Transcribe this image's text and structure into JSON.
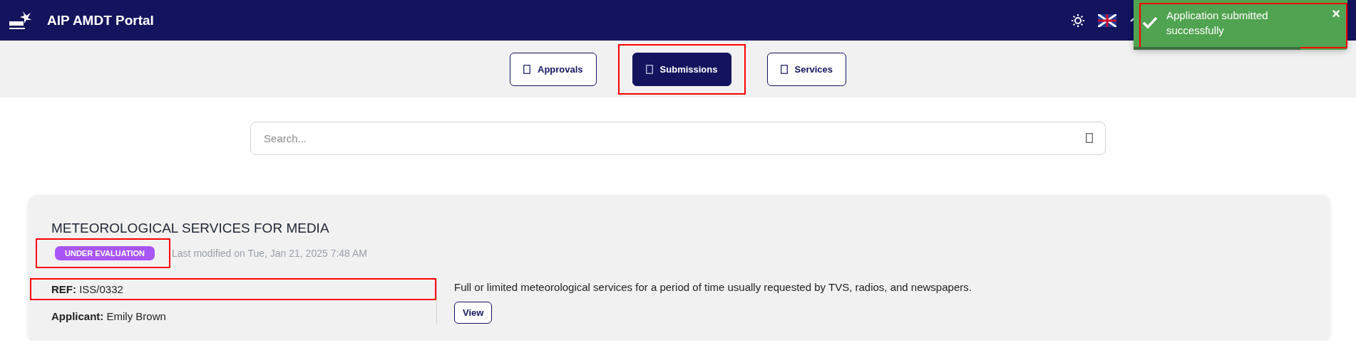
{
  "header": {
    "title": "AIP AMDT Portal"
  },
  "toast": {
    "message": "Application submitted successfully",
    "close": "×",
    "level": 0.78,
    "highlighted": true
  },
  "tabs": [
    {
      "label": "Approvals",
      "selected": false,
      "highlighted": false
    },
    {
      "label": "Submissions",
      "selected": true,
      "highlighted": true
    },
    {
      "label": "Services",
      "selected": false,
      "highlighted": false
    }
  ],
  "search": {
    "placeholder": "Search..."
  },
  "submissions": [
    {
      "title": "METEOROLOGICAL SERVICES FOR MEDIA",
      "status": "UNDER EVALUATION",
      "color": "#a855f7",
      "status_highlighted": true,
      "modified": "Last modified on Tue, Jan 21, 2025 7:48 AM",
      "ref_label": "REF:",
      "ref": "ISS/0332",
      "ref_highlighted": true,
      "applicant_label": "Applicant:",
      "applicant": "Emily Brown",
      "description": "Full or limited meteorological services for a period of time usually requested by TVS, radios, and newspapers.",
      "action": "View"
    }
  ]
}
